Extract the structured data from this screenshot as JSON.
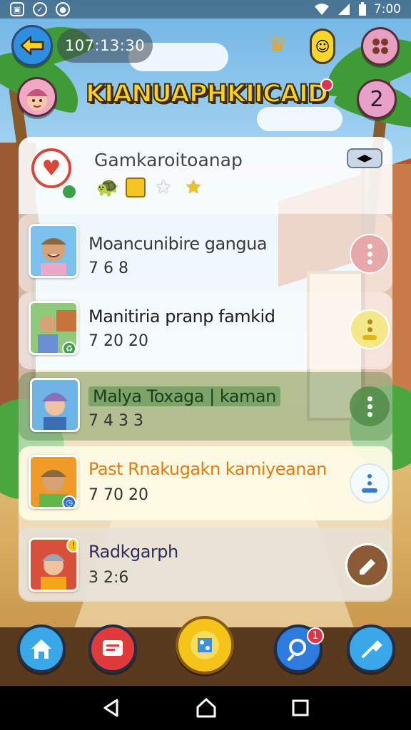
{
  "status_bar": {
    "time": "7:00",
    "left_icons": [
      "photo-icon",
      "sync-icon",
      "bell-icon"
    ],
    "right_icons": [
      "wifi-icon",
      "signal-icon",
      "battery-icon"
    ]
  },
  "header": {
    "timer": "107:13:30",
    "logo_text": "KIANUAPHKIICAID",
    "level": "2"
  },
  "list_header": {
    "title": "Gamkaroitoanap"
  },
  "rows": [
    {
      "name": "Moancunibire gangua",
      "score": "7 6 8",
      "name_color": "#3a3a3a"
    },
    {
      "name": "Manitiria pranp famkid",
      "score": "7 20 20",
      "name_color": "#1e1e1e"
    },
    {
      "name": "Malya Toxaga | kaman",
      "score": "7 4 3 3",
      "name_color": "#1e3b1e"
    },
    {
      "name": "Past Rnakugakn kamiyeanan",
      "score": "7 70 20",
      "name_color": "#e07b12"
    },
    {
      "name": "Radkgarph",
      "score": "3 2:6",
      "name_color": "#2e2e5a"
    }
  ],
  "bottom_nav": {
    "search_badge": "1"
  },
  "colors": {
    "accent_yellow": "#f5c419",
    "accent_blue": "#2e8fe0",
    "nav_bar": "#5a3a1e"
  }
}
